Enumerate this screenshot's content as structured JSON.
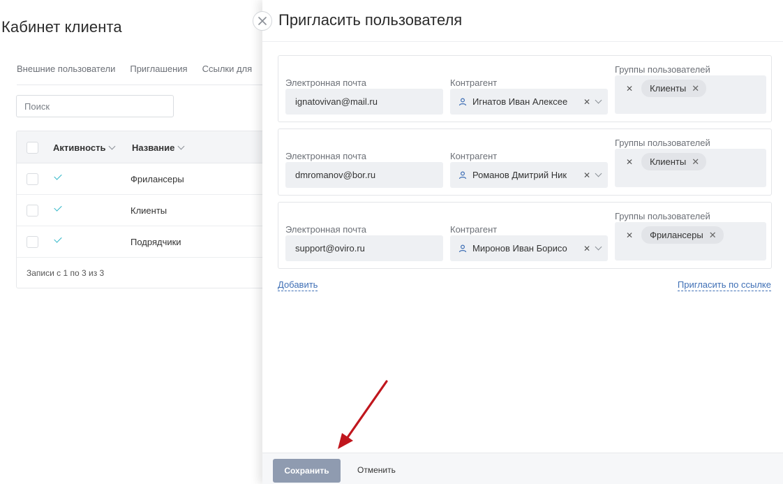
{
  "background": {
    "title": "Кабинет клиента",
    "tabs": [
      "Внешние пользователи",
      "Приглашения",
      "Ссылки для"
    ],
    "search_placeholder": "Поиск",
    "table": {
      "columns": [
        "Активность",
        "Название"
      ],
      "rows": [
        {
          "name": "Фрилансеры"
        },
        {
          "name": "Клиенты"
        },
        {
          "name": "Подрядчики"
        }
      ],
      "footer": "Записи с 1 по 3 из 3"
    }
  },
  "panel": {
    "title": "Пригласить пользователя",
    "labels": {
      "email": "Электронная почта",
      "contractor": "Контрагент",
      "groups": "Группы пользователей"
    },
    "invites": [
      {
        "email": "ignatovivan@mail.ru",
        "contractor": "Игнатов Иван Алексее",
        "group": "Клиенты"
      },
      {
        "email": "dmromanov@bor.ru",
        "contractor": "Романов Дмитрий Ник",
        "group": "Клиенты"
      },
      {
        "email": "support@oviro.ru",
        "contractor": "Миронов Иван Борисо",
        "group": "Фрилансеры"
      }
    ],
    "add_link": "Добавить",
    "invite_by_link": "Пригласить по ссылке",
    "save_label": "Сохранить",
    "cancel_label": "Отменить"
  },
  "colors": {
    "accent": "#3f6fb5",
    "check": "#2cb5c7",
    "save_button": "#8f9bb0",
    "arrow": "#c0161d"
  },
  "icons": {
    "close": "close-icon",
    "user": "user-icon",
    "chevron": "chevron-down-icon"
  }
}
